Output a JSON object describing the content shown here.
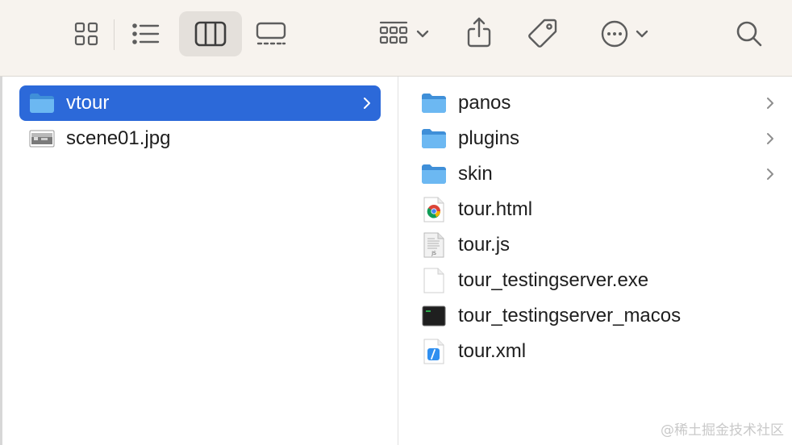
{
  "toolbar": {
    "buttons": [
      {
        "name": "icon-view",
        "icon": "grid-icon"
      },
      {
        "name": "list-view",
        "icon": "list-icon"
      },
      {
        "name": "column-view",
        "icon": "columns-icon",
        "active": true
      },
      {
        "name": "gallery-view",
        "icon": "gallery-icon"
      },
      {
        "name": "group",
        "icon": "group-icon"
      },
      {
        "name": "share",
        "icon": "share-icon"
      },
      {
        "name": "tags",
        "icon": "tag-icon"
      },
      {
        "name": "more-actions",
        "icon": "ellipsis-icon"
      },
      {
        "name": "search",
        "icon": "search-icon"
      }
    ]
  },
  "columns": {
    "left": {
      "items": [
        {
          "label": "vtour",
          "icon": "folder-icon",
          "selected": true,
          "has_children": true
        },
        {
          "label": "scene01.jpg",
          "icon": "image-file-icon",
          "selected": false,
          "has_children": false
        }
      ]
    },
    "right": {
      "items": [
        {
          "label": "panos",
          "icon": "folder-icon",
          "has_children": true
        },
        {
          "label": "plugins",
          "icon": "folder-icon",
          "has_children": true
        },
        {
          "label": "skin",
          "icon": "folder-icon",
          "has_children": true
        },
        {
          "label": "tour.html",
          "icon": "chrome-html-file-icon",
          "has_children": false
        },
        {
          "label": "tour.js",
          "icon": "js-file-icon",
          "has_children": false
        },
        {
          "label": "tour_testingserver.exe",
          "icon": "blank-file-icon",
          "has_children": false
        },
        {
          "label": "tour_testingserver_macos",
          "icon": "terminal-exec-icon",
          "has_children": false
        },
        {
          "label": "tour.xml",
          "icon": "xml-file-icon",
          "has_children": false
        }
      ]
    }
  },
  "watermark": "@稀土掘金技术社区",
  "colors": {
    "toolbar_bg": "#f7f3ee",
    "selection": "#2c69d9",
    "folder_blue": "#5fb0ee",
    "text": "#1e1e1e"
  }
}
